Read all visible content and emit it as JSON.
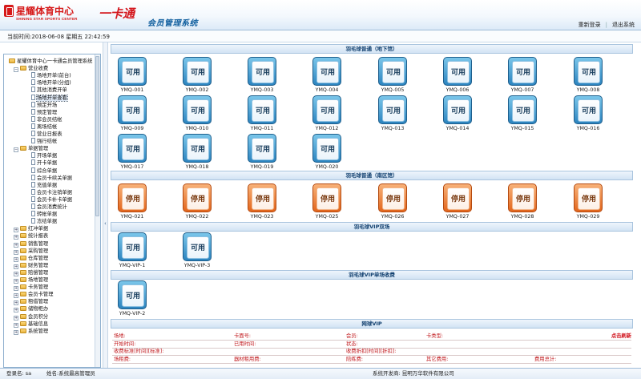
{
  "header": {
    "brand_cn": "星耀体育中心",
    "brand_en": "SHINING STAR SPORTS CENTER",
    "card_mark": "一卡通",
    "system_title": "会员管理系统",
    "relogin": "重新登录",
    "sep": "|",
    "exit": "退出系统"
  },
  "timebar": {
    "label": "当前时间:",
    "value": "2018-06-08 星期五 22:42:59"
  },
  "tree": [
    {
      "label": "星耀体育中心一卡通会员管理系统",
      "kind": "root"
    },
    {
      "label": "营业收费",
      "kind": "folder-open"
    },
    {
      "label": "场地开单(前台)",
      "kind": "leaf"
    },
    {
      "label": "场地开单(分组)",
      "kind": "leaf"
    },
    {
      "label": "其他消费开单",
      "kind": "leaf"
    },
    {
      "label": "场地开单查看",
      "kind": "leaf-sel"
    },
    {
      "label": "预定开场",
      "kind": "leaf"
    },
    {
      "label": "预定管理",
      "kind": "leaf"
    },
    {
      "label": "非会员结帐",
      "kind": "leaf"
    },
    {
      "label": "离场结帐",
      "kind": "leaf"
    },
    {
      "label": "营业日报表",
      "kind": "leaf"
    },
    {
      "label": "强行结帐",
      "kind": "leaf"
    },
    {
      "label": "单据管理",
      "kind": "folder-open"
    },
    {
      "label": "开场单据",
      "kind": "leaf"
    },
    {
      "label": "开卡单据",
      "kind": "leaf"
    },
    {
      "label": "综合单据",
      "kind": "leaf"
    },
    {
      "label": "会员卡续关单据",
      "kind": "leaf"
    },
    {
      "label": "充值单据",
      "kind": "leaf"
    },
    {
      "label": "会员卡注销单据",
      "kind": "leaf"
    },
    {
      "label": "会员卡补卡单据",
      "kind": "leaf"
    },
    {
      "label": "会员消费统计",
      "kind": "leaf"
    },
    {
      "label": "转帐单据",
      "kind": "leaf"
    },
    {
      "label": "冻结单据",
      "kind": "leaf"
    },
    {
      "label": "红冲单据",
      "kind": "folder"
    },
    {
      "label": "统计报表",
      "kind": "folder"
    },
    {
      "label": "销售管理",
      "kind": "folder"
    },
    {
      "label": "采购管理",
      "kind": "folder"
    },
    {
      "label": "仓库管理",
      "kind": "folder"
    },
    {
      "label": "财务管理",
      "kind": "folder"
    },
    {
      "label": "赔偿管理",
      "kind": "folder"
    },
    {
      "label": "场地管理",
      "kind": "folder"
    },
    {
      "label": "卡务管理",
      "kind": "folder"
    },
    {
      "label": "会员卡管理",
      "kind": "folder"
    },
    {
      "label": "租借管理",
      "kind": "folder"
    },
    {
      "label": "储物柜办",
      "kind": "folder"
    },
    {
      "label": "会员积分",
      "kind": "folder"
    },
    {
      "label": "基础信息",
      "kind": "folder"
    },
    {
      "label": "系统管理",
      "kind": "folder"
    }
  ],
  "sections": [
    {
      "title": "羽毛球普通（地下馆）"
    },
    {
      "title": "羽毛球普通（南区馆）"
    },
    {
      "title": "羽毛球VIP双场"
    },
    {
      "title": "羽毛球VIP单场收费"
    },
    {
      "title": "网球VIP"
    }
  ],
  "status": {
    "free": "可用",
    "stop": "停用"
  },
  "courts": [
    {
      "id": "YMQ-001",
      "status": "free"
    },
    {
      "id": "YMQ-002",
      "status": "free"
    },
    {
      "id": "YMQ-003",
      "status": "free"
    },
    {
      "id": "YMQ-004",
      "status": "free"
    },
    {
      "id": "YMQ-005",
      "status": "free"
    },
    {
      "id": "YMQ-006",
      "status": "free"
    },
    {
      "id": "YMQ-007",
      "status": "free"
    },
    {
      "id": "YMQ-008",
      "status": "free"
    },
    {
      "id": "YMQ-009",
      "status": "free"
    },
    {
      "id": "YMQ-010",
      "status": "free"
    },
    {
      "id": "YMQ-011",
      "status": "free"
    },
    {
      "id": "YMQ-012",
      "status": "free"
    },
    {
      "id": "YMQ-013",
      "status": "free"
    },
    {
      "id": "YMQ-014",
      "status": "free"
    },
    {
      "id": "YMQ-015",
      "status": "free"
    },
    {
      "id": "YMQ-016",
      "status": "free"
    },
    {
      "id": "YMQ-017",
      "status": "free"
    },
    {
      "id": "YMQ-018",
      "status": "free"
    },
    {
      "id": "YMQ-019",
      "status": "free"
    },
    {
      "id": "YMQ-020",
      "status": "free"
    },
    {
      "id": "YMQ-021",
      "status": "stop"
    },
    {
      "id": "YMQ-022",
      "status": "stop"
    },
    {
      "id": "YMQ-023",
      "status": "stop"
    },
    {
      "id": "YMQ-025",
      "status": "stop"
    },
    {
      "id": "YMQ-026",
      "status": "stop"
    },
    {
      "id": "YMQ-027",
      "status": "stop"
    },
    {
      "id": "YMQ-028",
      "status": "stop"
    },
    {
      "id": "YMQ-029",
      "status": "stop"
    },
    {
      "id": "YMQ-VIP-1",
      "status": "free"
    },
    {
      "id": "YMQ-VIP-3",
      "status": "free"
    },
    {
      "id": "YMQ-VIP-2",
      "status": "free"
    }
  ],
  "info": {
    "row1": [
      "场地:",
      "卡面号:",
      "会员:",
      "卡类型:"
    ],
    "refresh": "点击刷新",
    "row2": [
      "开始时间:",
      "已用时间:",
      "状态:"
    ],
    "row3": [
      "收费标准[时间][标准]:",
      "收费折扣[时间][折扣]:"
    ],
    "row4": [
      "场租费:",
      "器材租用费:",
      "陪练费:",
      "其它费用:",
      "费用总计:"
    ]
  },
  "footer": {
    "user_label": "登录名:",
    "user": "sa",
    "name_label": "姓名:",
    "name": "系统最高管理员",
    "dev_label": "系统开发商:",
    "dev": "昆明万华软件有限公司"
  },
  "colors": {
    "accent": "#0f5e9e",
    "brand_red": "#d61a1a",
    "free": "#2c84bf",
    "stop": "#e2651c"
  }
}
